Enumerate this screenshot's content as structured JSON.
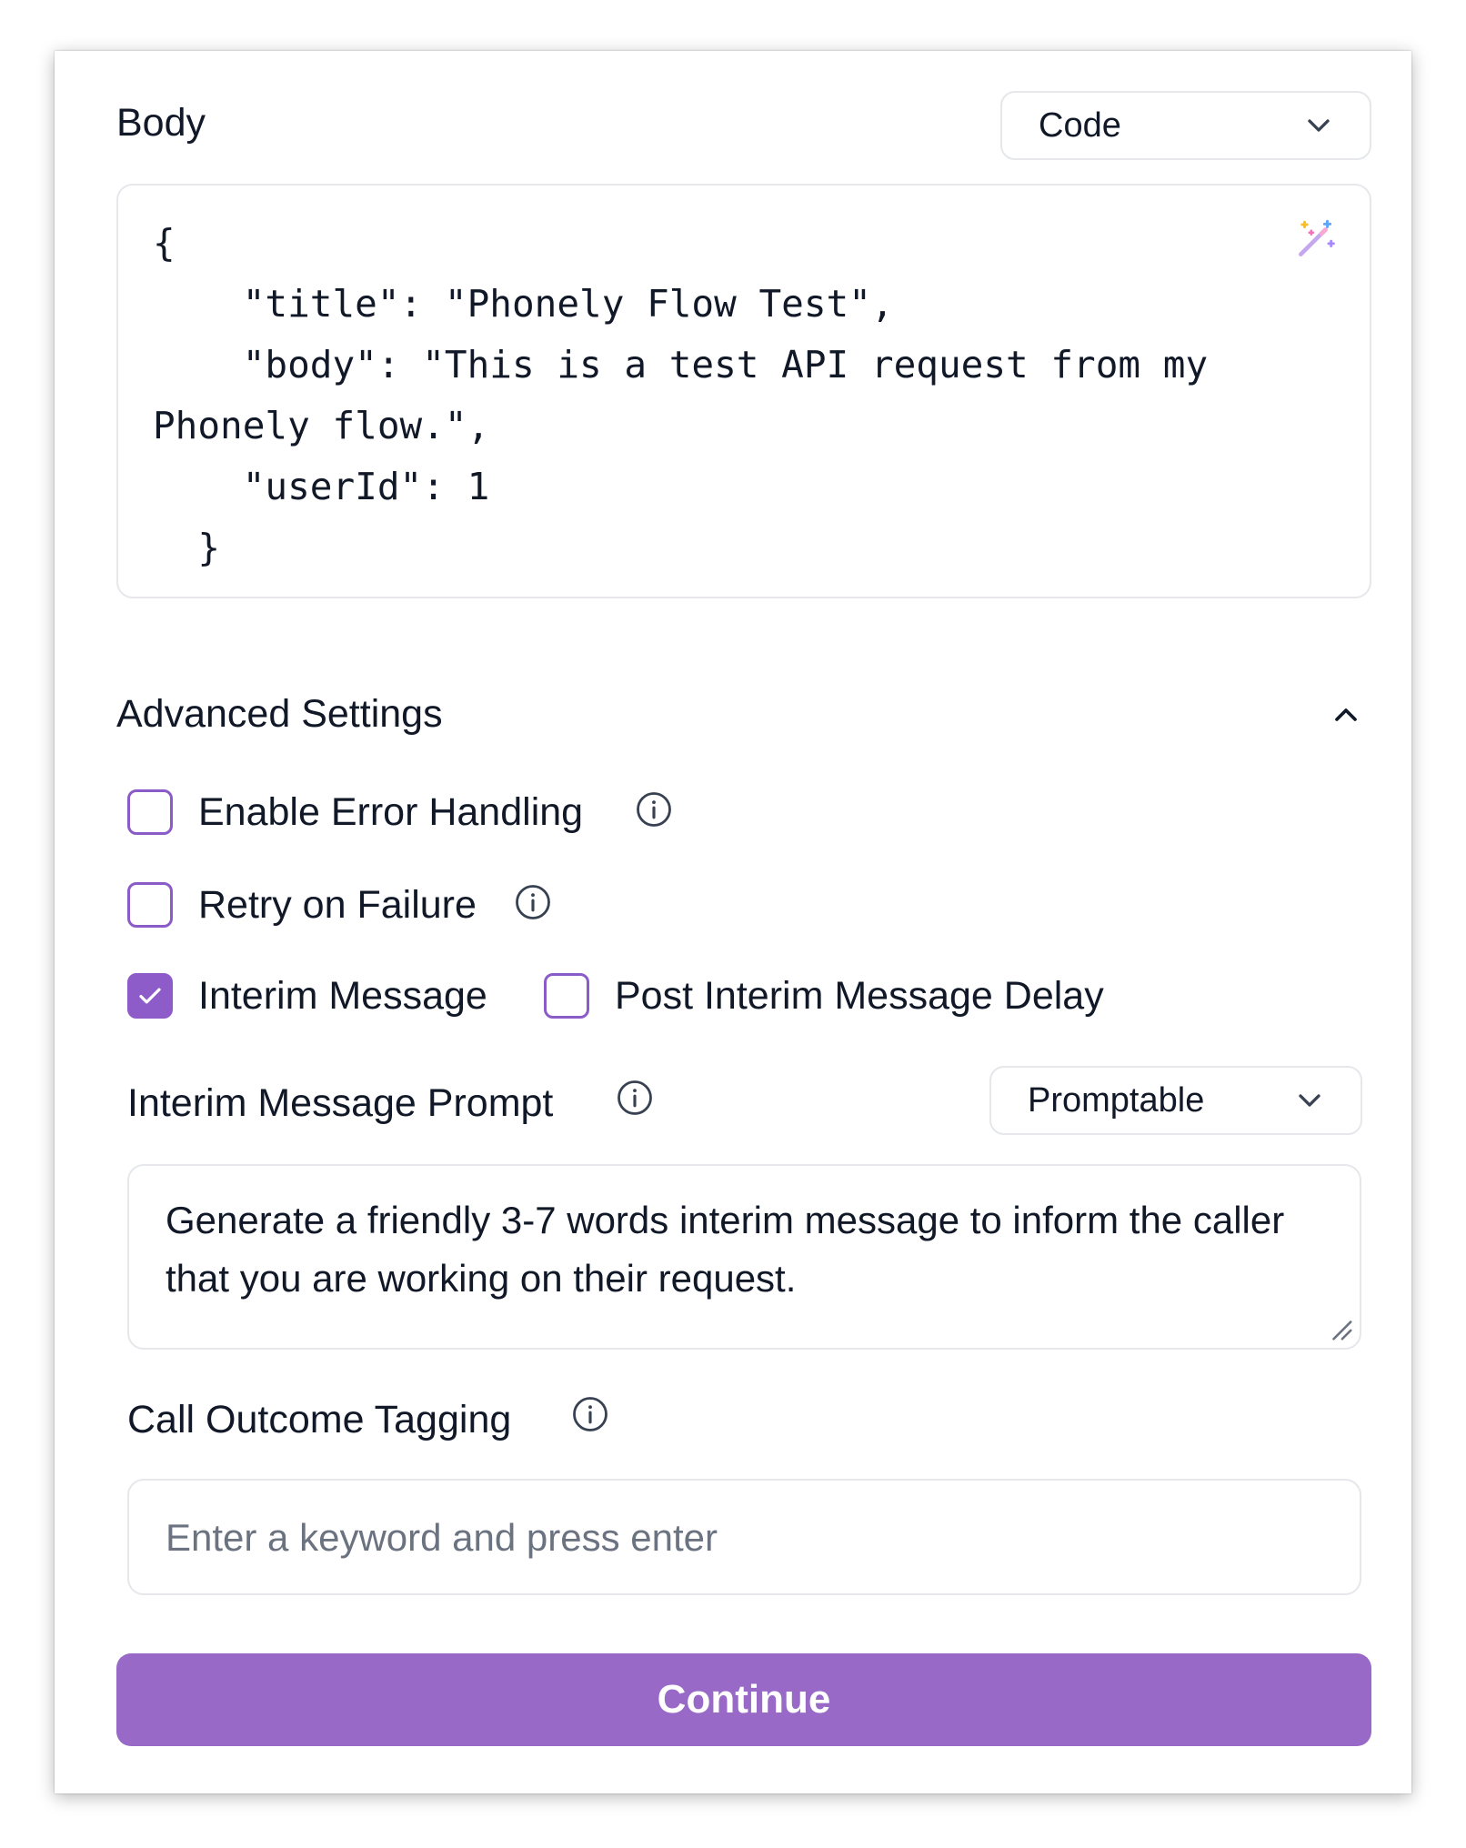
{
  "body_section": {
    "title": "Body",
    "mode_select": {
      "value": "Code"
    },
    "code": "{\n    \"title\": \"Phonely Flow Test\",\n    \"body\": \"This is a test API request from my Phonely flow.\",\n    \"userId\": 1\n  }",
    "magic_icon": "magic-wand-icon"
  },
  "advanced_settings": {
    "title": "Advanced Settings",
    "expanded": true,
    "options": {
      "error_handling": {
        "label": "Enable Error Handling",
        "checked": false
      },
      "retry": {
        "label": "Retry on Failure",
        "checked": false
      },
      "interim_message": {
        "label": "Interim Message",
        "checked": true
      },
      "post_interim_delay": {
        "label": "Post Interim Message Delay",
        "checked": false
      }
    },
    "interim_prompt": {
      "label": "Interim Message Prompt",
      "type_select": {
        "value": "Promptable"
      },
      "value": "Generate a friendly 3-7 words interim message to inform the caller that you are working on their request."
    },
    "call_outcome": {
      "label": "Call Outcome Tagging",
      "placeholder": "Enter a keyword and press enter"
    }
  },
  "actions": {
    "continue_label": "Continue"
  },
  "colors": {
    "accent": "#9869c7",
    "checkbox_border": "#8b5cc7",
    "border": "#e5e7eb",
    "text": "#111827",
    "placeholder": "#6b7280"
  }
}
